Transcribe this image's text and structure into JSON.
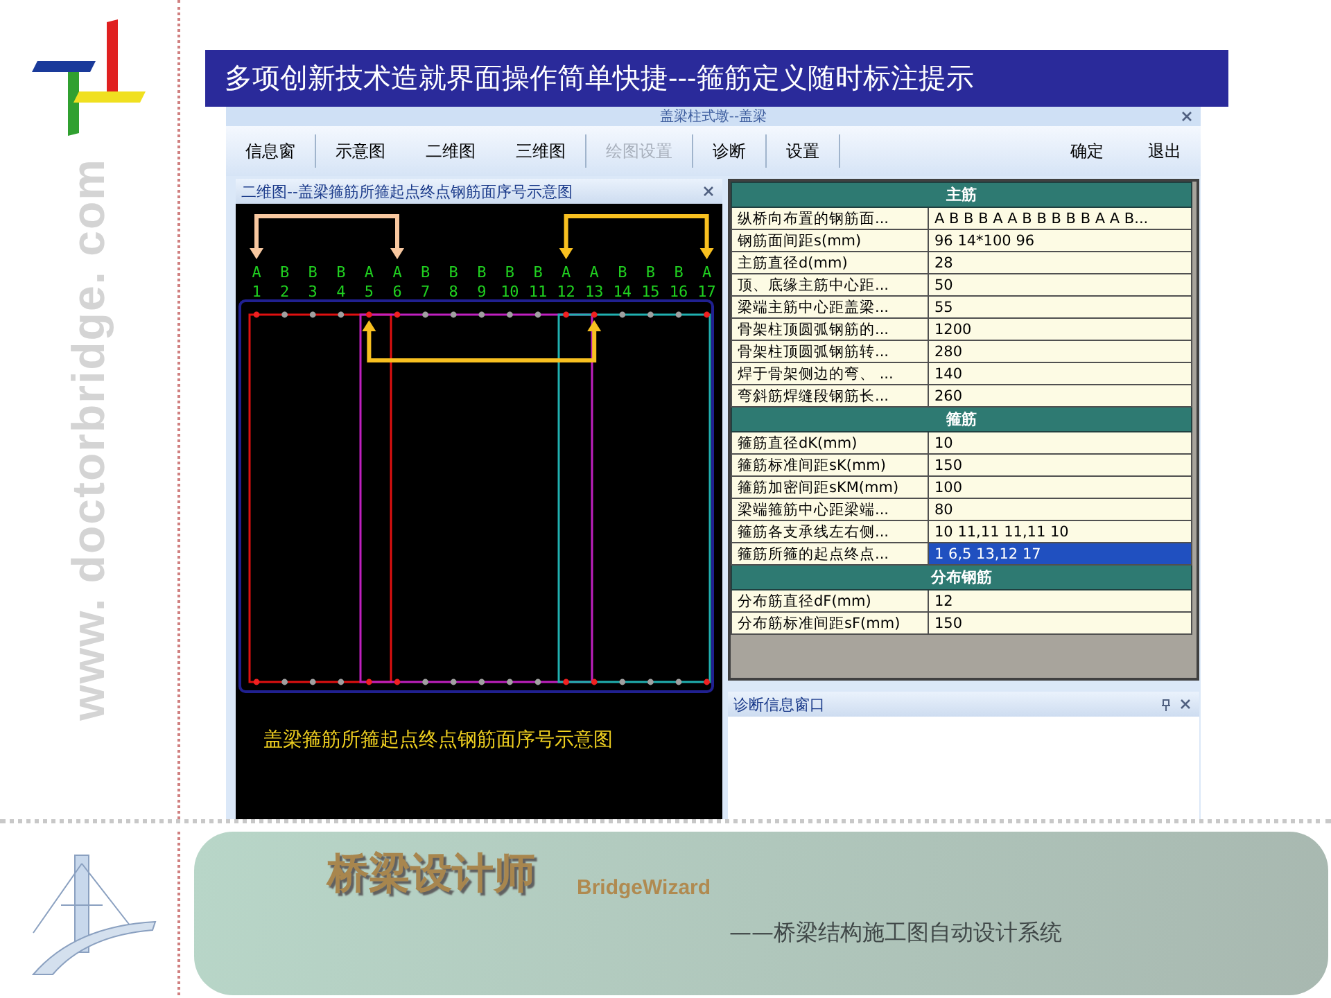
{
  "side_text": "www. doctorbridge. com",
  "banner": "多项创新技术造就界面操作简单快捷---箍筋定义随时标注提示",
  "window": {
    "title": "盖梁柱式墩--盖梁"
  },
  "toolbar": [
    {
      "label": "信息窗",
      "disabled": false,
      "sep": true
    },
    {
      "label": "示意图",
      "disabled": false,
      "sep": false
    },
    {
      "label": "二维图",
      "disabled": false,
      "sep": false
    },
    {
      "label": "三维图",
      "disabled": false,
      "sep": true
    },
    {
      "label": "绘图设置",
      "disabled": true,
      "sep": true
    },
    {
      "label": "诊断",
      "disabled": false,
      "sep": true
    },
    {
      "label": "设置",
      "disabled": false,
      "sep": true
    }
  ],
  "toolbar_right": [
    "确定",
    "退出"
  ],
  "drawing_pane": {
    "title": "二维图--盖梁箍筋所箍起点终点钢筋面序号示意图",
    "positions": [
      {
        "type": "A",
        "number": "1"
      },
      {
        "type": "B",
        "number": "2"
      },
      {
        "type": "B",
        "number": "3"
      },
      {
        "type": "B",
        "number": "4"
      },
      {
        "type": "A",
        "number": "5"
      },
      {
        "type": "A",
        "number": "6"
      },
      {
        "type": "B",
        "number": "7"
      },
      {
        "type": "B",
        "number": "8"
      },
      {
        "type": "B",
        "number": "9"
      },
      {
        "type": "B",
        "number": "10"
      },
      {
        "type": "B",
        "number": "11"
      },
      {
        "type": "A",
        "number": "12"
      },
      {
        "type": "A",
        "number": "13"
      },
      {
        "type": "B",
        "number": "14"
      },
      {
        "type": "B",
        "number": "15"
      },
      {
        "type": "B",
        "number": "16"
      },
      {
        "type": "A",
        "number": "17"
      }
    ],
    "stirrups": [
      {
        "color": "#e01010"
      },
      {
        "color": "#c020c0"
      },
      {
        "color": "#20b0b0"
      }
    ],
    "arrows": [
      {
        "color": "#f8c8a0"
      },
      {
        "color": "#f8c020"
      },
      {
        "color": "#f8c020"
      }
    ],
    "caption": "盖梁箍筋所箍起点终点钢筋面序号示意图"
  },
  "property_table": [
    {
      "section": "主筋",
      "rows": [
        {
          "label": "纵桥向布置的钢筋面...",
          "value": "A B B B A A B B B B B A A B...",
          "selected": false
        },
        {
          "label": "钢筋面间距s(mm)",
          "value": "96 14*100  96",
          "selected": false
        },
        {
          "label": "主筋直径d(mm)",
          "value": "28",
          "selected": false
        },
        {
          "label": "顶、底缘主筋中心距...",
          "value": "50",
          "selected": false
        },
        {
          "label": "梁端主筋中心距盖梁...",
          "value": "55",
          "selected": false
        },
        {
          "label": "骨架柱顶圆弧钢筋的...",
          "value": "1200",
          "selected": false
        },
        {
          "label": "骨架柱顶圆弧钢筋转...",
          "value": "280",
          "selected": false
        },
        {
          "label": "焊于骨架侧边的弯、 ...",
          "value": "140",
          "selected": false
        },
        {
          "label": "弯斜筋焊缝段钢筋长...",
          "value": "260",
          "selected": false
        }
      ]
    },
    {
      "section": "箍筋",
      "rows": [
        {
          "label": "箍筋直径dK(mm)",
          "value": "10",
          "selected": false
        },
        {
          "label": "箍筋标准间距sK(mm)",
          "value": "150",
          "selected": false
        },
        {
          "label": "箍筋加密间距sKM(mm)",
          "value": "100",
          "selected": false
        },
        {
          "label": "梁端箍筋中心距梁端...",
          "value": "80",
          "selected": false
        },
        {
          "label": "箍筋各支承线左右侧...",
          "value": "10 11,11 11,11 10",
          "selected": false
        },
        {
          "label": "箍筋所箍的起点终点...",
          "value": "1 6,5 13,12 17",
          "selected": true
        }
      ]
    },
    {
      "section": "分布钢筋",
      "rows": [
        {
          "label": "分布筋直径dF(mm)",
          "value": "12",
          "selected": false
        },
        {
          "label": "分布筋标准间距sF(mm)",
          "value": "150",
          "selected": false
        }
      ]
    }
  ],
  "diagnostic_pane": {
    "title": "诊断信息窗口"
  },
  "footer": {
    "product": "桥梁设计师",
    "product_en": "BridgeWizard",
    "subtitle": "——桥梁结构施工图自动设计系统"
  }
}
